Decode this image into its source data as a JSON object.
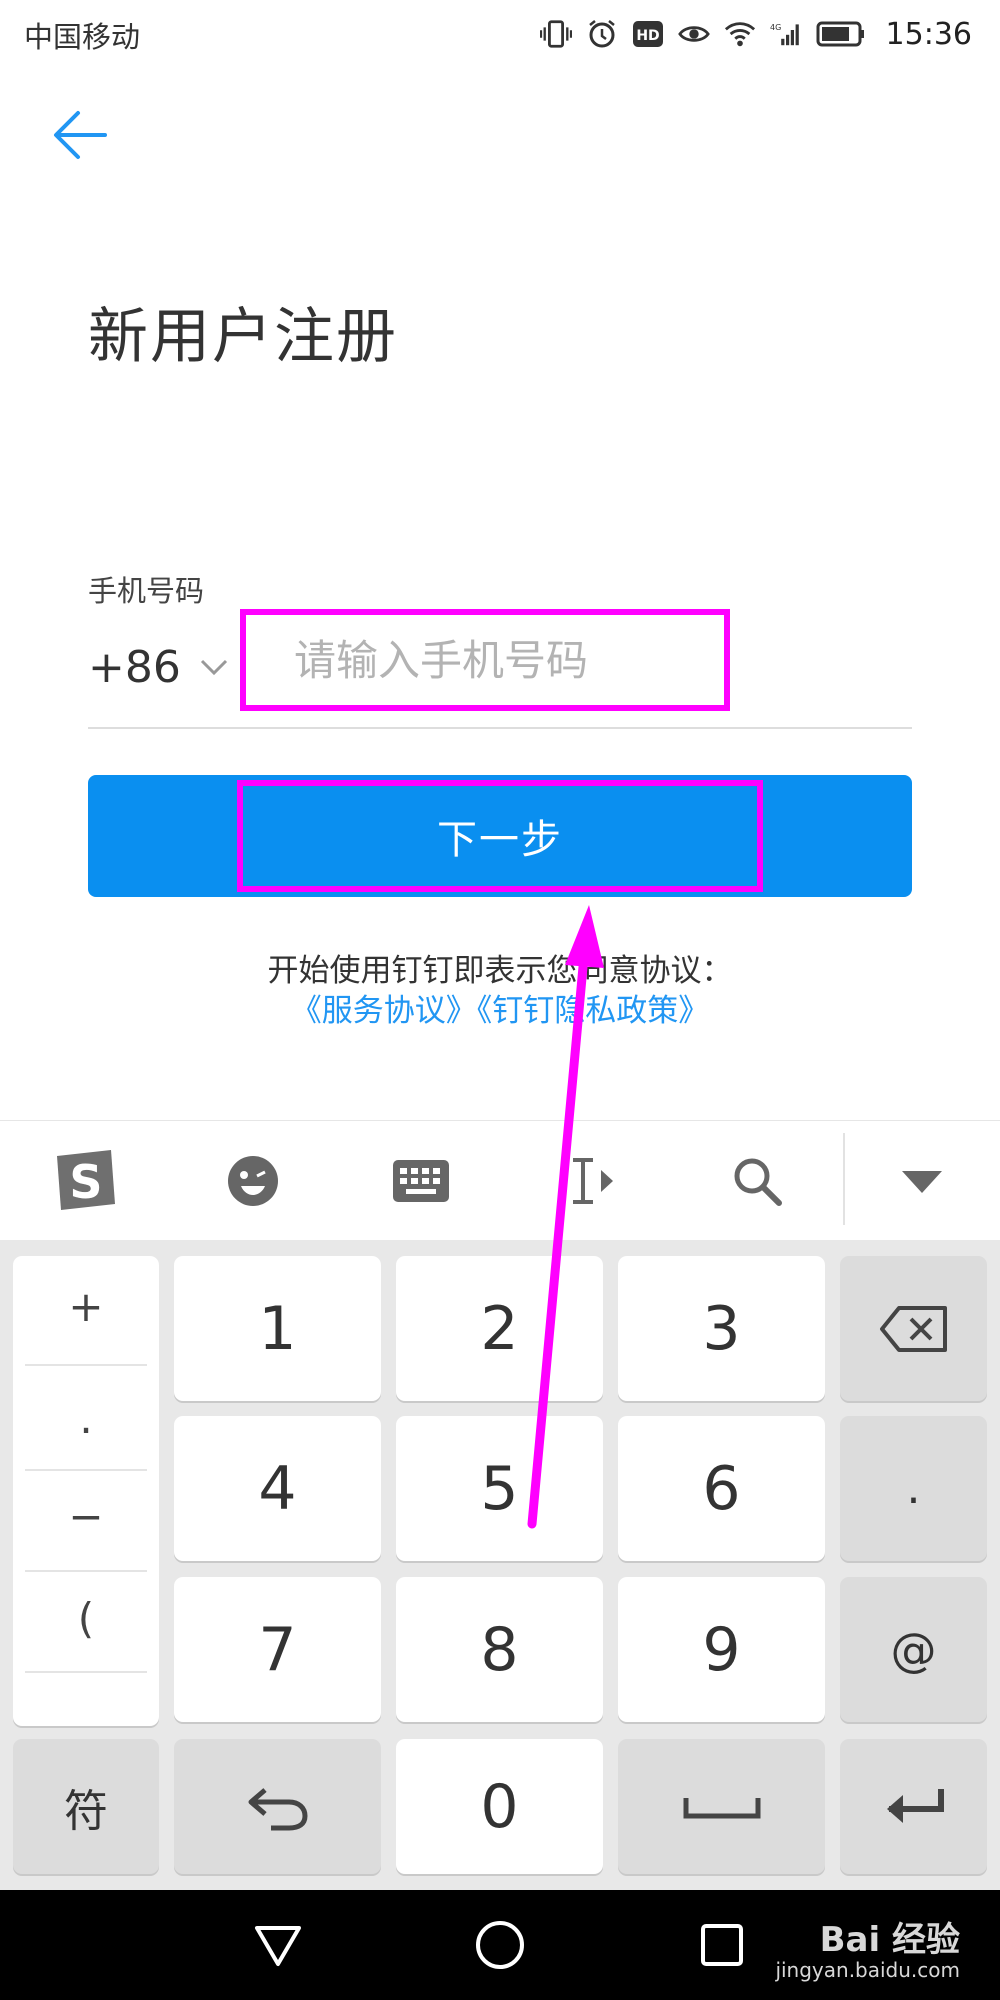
{
  "status_bar": {
    "carrier": "中国移动",
    "time": "15:36",
    "icons": [
      "vibrate-icon",
      "alarm-icon",
      "hd-icon",
      "eye-icon",
      "wifi-icon",
      "signal-4g-icon",
      "battery-icon"
    ]
  },
  "header": {
    "back_icon": "arrow-left-icon",
    "title": "新用户注册"
  },
  "form": {
    "phone_label": "手机号码",
    "country_code": "+86",
    "phone_placeholder": "请输入手机号码",
    "phone_value": "",
    "next_label": "下一步"
  },
  "agreement": {
    "text": "开始使用钉钉即表示您同意协议：",
    "link_service": "《服务协议》",
    "link_privacy": "《钉钉隐私政策》"
  },
  "keyboard": {
    "toolbar": [
      "sogou-logo-icon",
      "emoji-icon",
      "keyboard-icon",
      "cursor-icon",
      "search-icon",
      "collapse-icon"
    ],
    "side_keys": [
      "+",
      ".",
      "−",
      "("
    ],
    "row1": [
      "1",
      "2",
      "3"
    ],
    "row2": [
      "4",
      "5",
      "6"
    ],
    "row3": [
      "7",
      "8",
      "9"
    ],
    "right_keys": {
      "row2": ".",
      "row3": "@"
    },
    "symbols_label": "符",
    "zero": "0"
  },
  "nav_bar": {
    "watermark": "Bai 经验",
    "watermark_url": "jingyan.baidu.com"
  },
  "colors": {
    "primary": "#0a8ff0",
    "link": "#2196f3",
    "annotation": "#ff00ff"
  }
}
